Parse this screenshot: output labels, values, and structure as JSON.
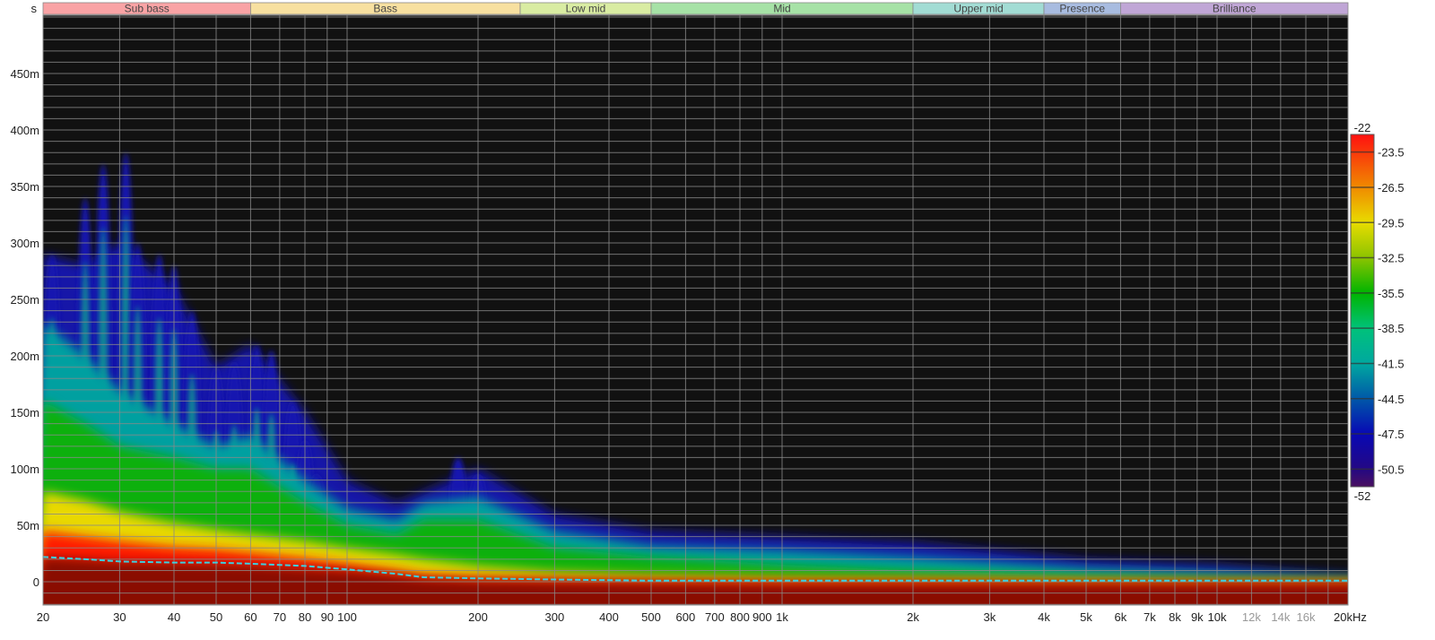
{
  "chart_data": {
    "type": "heatmap",
    "title": "Spectrogram",
    "ylabel": "s",
    "xlabel": "kHz",
    "x_scale": "log",
    "xlim": [
      20,
      20000
    ],
    "ylim": [
      -20.6,
      501.6
    ],
    "grid": true,
    "x_ticks": [
      {
        "v": 20,
        "label": "20"
      },
      {
        "v": 30,
        "label": "30"
      },
      {
        "v": 40,
        "label": "40"
      },
      {
        "v": 50,
        "label": "50"
      },
      {
        "v": 60,
        "label": "60"
      },
      {
        "v": 70,
        "label": "70"
      },
      {
        "v": 80,
        "label": "80"
      },
      {
        "v": 90,
        "label": "90"
      },
      {
        "v": 100,
        "label": "100"
      },
      {
        "v": 200,
        "label": "200"
      },
      {
        "v": 300,
        "label": "300"
      },
      {
        "v": 400,
        "label": "400"
      },
      {
        "v": 500,
        "label": "500"
      },
      {
        "v": 600,
        "label": "600"
      },
      {
        "v": 700,
        "label": "700"
      },
      {
        "v": 800,
        "label": "800"
      },
      {
        "v": 900,
        "label": "900"
      },
      {
        "v": 1000,
        "label": "1k"
      },
      {
        "v": 2000,
        "label": "2k"
      },
      {
        "v": 3000,
        "label": "3k"
      },
      {
        "v": 4000,
        "label": "4k"
      },
      {
        "v": 5000,
        "label": "5k"
      },
      {
        "v": 6000,
        "label": "6k"
      },
      {
        "v": 7000,
        "label": "7k"
      },
      {
        "v": 8000,
        "label": "8k"
      },
      {
        "v": 9000,
        "label": "9k"
      },
      {
        "v": 10000,
        "label": "10k"
      },
      {
        "v": 12000,
        "label": "12k",
        "muted": true
      },
      {
        "v": 14000,
        "label": "14k",
        "muted": true
      },
      {
        "v": 16000,
        "label": "16k",
        "muted": true
      },
      {
        "v": 18000,
        "label": ""
      },
      {
        "v": 20000,
        "label": "20kHz"
      }
    ],
    "y_ticks": [
      {
        "v": 0,
        "label": "0"
      },
      {
        "v": 50,
        "label": "50m"
      },
      {
        "v": 100,
        "label": "100m"
      },
      {
        "v": 150,
        "label": "150m"
      },
      {
        "v": 200,
        "label": "200m"
      },
      {
        "v": 250,
        "label": "250m"
      },
      {
        "v": 300,
        "label": "300m"
      },
      {
        "v": 350,
        "label": "350m"
      },
      {
        "v": 400,
        "label": "400m"
      },
      {
        "v": 450,
        "label": "450m"
      }
    ],
    "y_minor_step_ms": 10,
    "bands": [
      {
        "label": "Sub bass",
        "from": 20,
        "to": 60,
        "color": "#f9a3a5"
      },
      {
        "label": "Bass",
        "from": 60,
        "to": 250,
        "color": "#f7e0a0"
      },
      {
        "label": "Low mid",
        "from": 250,
        "to": 500,
        "color": "#d9eca2"
      },
      {
        "label": "Mid",
        "from": 500,
        "to": 2000,
        "color": "#a6e2a6"
      },
      {
        "label": "Upper mid",
        "from": 2000,
        "to": 4000,
        "color": "#a2dcd4"
      },
      {
        "label": "Presence",
        "from": 4000,
        "to": 6000,
        "color": "#a8bce0"
      },
      {
        "label": "Brilliance",
        "from": 6000,
        "to": 20000,
        "color": "#c0a6d6"
      }
    ],
    "colorbar": {
      "max": -22,
      "min": -52,
      "max_label": "-22",
      "min_label": "-52",
      "ticks": [
        "-23.5",
        "-26.5",
        "-29.5",
        "-32.5",
        "-35.5",
        "-38.5",
        "-41.5",
        "-44.5",
        "-47.5",
        "-50.5"
      ],
      "stops": [
        {
          "v": -22,
          "c": "#ff1010"
        },
        {
          "v": -26.5,
          "c": "#f08a00"
        },
        {
          "v": -29.5,
          "c": "#e8dc00"
        },
        {
          "v": -32.5,
          "c": "#8cc400"
        },
        {
          "v": -35.5,
          "c": "#00b400"
        },
        {
          "v": -38.5,
          "c": "#00c27a"
        },
        {
          "v": -41.5,
          "c": "#00a8a0"
        },
        {
          "v": -44.5,
          "c": "#0058a8"
        },
        {
          "v": -47.5,
          "c": "#0808b4"
        },
        {
          "v": -50.5,
          "c": "#240884"
        },
        {
          "v": -52,
          "c": "#4a1060"
        }
      ]
    },
    "decay_contours_ms": {
      "freqs": [
        20,
        25,
        30,
        40,
        50,
        60,
        80,
        100,
        130,
        150,
        200,
        300,
        500,
        1000,
        2000,
        5000,
        10000,
        20000
      ],
      "levels": [
        {
          "db": -50,
          "color": "#1414a8",
          "ms": [
            290,
            280,
            300,
            260,
            190,
            210,
            150,
            90,
            70,
            80,
            100,
            60,
            45,
            40,
            35,
            20,
            15,
            6
          ]
        },
        {
          "db": -44,
          "color": "#00a0a0",
          "ms": [
            230,
            200,
            170,
            140,
            120,
            130,
            90,
            65,
            55,
            70,
            75,
            45,
            32,
            28,
            22,
            12,
            8,
            3
          ]
        },
        {
          "db": -36,
          "color": "#10b010",
          "ms": [
            160,
            140,
            120,
            110,
            100,
            100,
            70,
            50,
            42,
            55,
            55,
            30,
            22,
            15,
            10,
            5,
            3,
            2
          ]
        },
        {
          "db": -30,
          "color": "#e8d800",
          "ms": [
            80,
            72,
            62,
            52,
            46,
            42,
            36,
            30,
            24,
            20,
            14,
            9,
            6,
            4,
            3,
            2,
            1,
            1
          ]
        },
        {
          "db": -24,
          "color": "#ff1a00",
          "ms": [
            45,
            40,
            36,
            31,
            29,
            26,
            21,
            16,
            10,
            6,
            4,
            3,
            2,
            1,
            1,
            0,
            0,
            0
          ]
        },
        {
          "db": -20,
          "color": "#8a1000",
          "ms": [
            22,
            20,
            18,
            17,
            16,
            15,
            12,
            10,
            6,
            3,
            1,
            0,
            -1,
            -2,
            -2,
            -2,
            -2,
            -2
          ]
        }
      ]
    },
    "ridges": [
      {
        "freq": 21,
        "top_ms": 290
      },
      {
        "freq": 25,
        "top_ms": 340
      },
      {
        "freq": 27.5,
        "top_ms": 370
      },
      {
        "freq": 31,
        "top_ms": 380
      },
      {
        "freq": 33,
        "top_ms": 300
      },
      {
        "freq": 37,
        "top_ms": 290
      },
      {
        "freq": 40,
        "top_ms": 280
      },
      {
        "freq": 44,
        "top_ms": 240
      },
      {
        "freq": 50,
        "top_ms": 190
      },
      {
        "freq": 55,
        "top_ms": 195
      },
      {
        "freq": 62,
        "top_ms": 210
      },
      {
        "freq": 67,
        "top_ms": 205
      },
      {
        "freq": 75,
        "top_ms": 160
      },
      {
        "freq": 80,
        "top_ms": 125
      },
      {
        "freq": 85,
        "top_ms": 95
      },
      {
        "freq": 180,
        "top_ms": 110
      },
      {
        "freq": 200,
        "top_ms": 95
      }
    ],
    "series": [
      {
        "name": "arrival",
        "color": "#3cd0e0",
        "x": [
          20,
          25,
          30,
          40,
          50,
          60,
          80,
          100,
          130,
          150,
          200,
          300,
          500,
          1000,
          2000,
          5000,
          10000,
          20000
        ],
        "y_ms": [
          22,
          20,
          18,
          17,
          17,
          16,
          14,
          11,
          7,
          4,
          3,
          2,
          1,
          1,
          1,
          1,
          1,
          1
        ]
      }
    ]
  }
}
